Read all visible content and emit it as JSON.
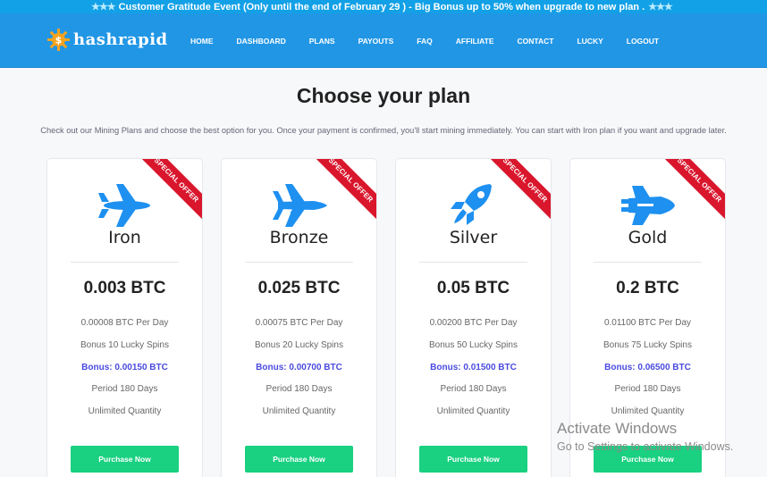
{
  "promo": {
    "stars": "★★★",
    "text": "Customer Gratitude Event (Only until the end of February 29 ) - Big Bonus up to 50% when upgrade to new plan ."
  },
  "brand": {
    "name": "hashrapid",
    "mark": "$"
  },
  "nav": [
    "HOME",
    "DASHBOARD",
    "PLANS",
    "PAYOUTS",
    "FAQ",
    "AFFILIATE",
    "CONTACT",
    "LUCKY",
    "LOGOUT"
  ],
  "page": {
    "title": "Choose your plan",
    "subtitle": "Check out our Mining Plans and choose the best option for you. Once your payment is confirmed, you'll start mining immediately. You can start with Iron plan if you want and upgrade later."
  },
  "plans": [
    {
      "ribbon": "SPECIAL OFFER",
      "icon": "airplane-icon",
      "name": "Iron",
      "price": "0.003 BTC",
      "per_day": "0.00008 BTC Per Day",
      "spins": "Bonus 10 Lucky Spins",
      "bonus": "Bonus: 0.00150 BTC",
      "period": "Period 180 Days",
      "quantity": "Unlimited Quantity",
      "button": "Purchase Now"
    },
    {
      "ribbon": "SPECIAL OFFER",
      "icon": "fighter-jet-icon",
      "name": "Bronze",
      "price": "0.025 BTC",
      "per_day": "0.00075 BTC Per Day",
      "spins": "Bonus 20 Lucky Spins",
      "bonus": "Bonus: 0.00700 BTC",
      "period": "Period 180 Days",
      "quantity": "Unlimited Quantity",
      "button": "Purchase Now"
    },
    {
      "ribbon": "SPECIAL OFFER",
      "icon": "rocket-icon",
      "name": "Silver",
      "price": "0.05 BTC",
      "per_day": "0.00200 BTC Per Day",
      "spins": "Bonus 50 Lucky Spins",
      "bonus": "Bonus: 0.01500 BTC",
      "period": "Period 180 Days",
      "quantity": "Unlimited Quantity",
      "button": "Purchase Now"
    },
    {
      "ribbon": "SPECIAL OFFER",
      "icon": "space-shuttle-icon",
      "name": "Gold",
      "price": "0.2 BTC",
      "per_day": "0.01100 BTC Per Day",
      "spins": "Bonus 75 Lucky Spins",
      "bonus": "Bonus: 0.06500 BTC",
      "period": "Period 180 Days",
      "quantity": "Unlimited Quantity",
      "button": "Purchase Now"
    }
  ],
  "watermark": {
    "line1": "Activate Windows",
    "line2": "Go to Settings to activate Windows."
  },
  "colors": {
    "nav_bg": "#2196e5",
    "promo_bg": "#12a0e6",
    "icon_blue": "#1e90f0",
    "ribbon_red": "#d9162c",
    "button_green": "#1ad081",
    "bonus_text": "#4a4ae0"
  }
}
